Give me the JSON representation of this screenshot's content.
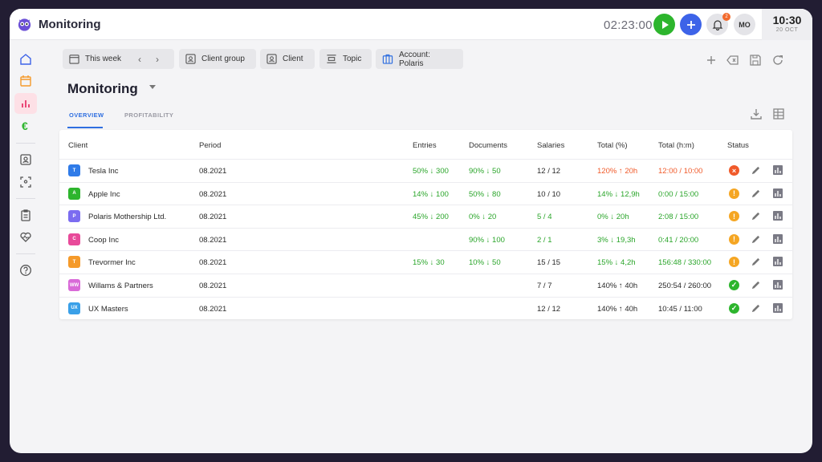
{
  "app": {
    "title": "Monitoring",
    "timer": "02:23:00",
    "avatar": "MO",
    "notifications": "2",
    "clock_time": "10:30",
    "clock_date": "20 OCT"
  },
  "filters": {
    "period": "This week",
    "client_group": "Client group",
    "client": "Client",
    "topic": "Topic",
    "account": "Account: Polaris"
  },
  "page": {
    "title": "Monitoring",
    "tabs": [
      "OVERVIEW",
      "PROFITABILITY"
    ]
  },
  "table": {
    "headers": [
      "Client",
      "Period",
      "Entries",
      "Documents",
      "Salaries",
      "Total (%)",
      "Total (h:m)",
      "Status"
    ],
    "rows": [
      {
        "initials": "T",
        "color": "#2f7be8",
        "client": "Tesla Inc",
        "period": "08.2021",
        "entries": "50% ↓ 300",
        "documents": "90% ↓ 50",
        "salaries": "12 / 12",
        "total_pct": "120% ↑ 20h",
        "total_hm": "12:00 / 10:00",
        "status": "error"
      },
      {
        "initials": "A",
        "color": "#2db52d",
        "client": "Apple Inc",
        "period": "08.2021",
        "entries": "14% ↓ 100",
        "documents": "50% ↓ 80",
        "salaries": "10 / 10",
        "total_pct": "14% ↓ 12,9h",
        "total_hm": "0:00 / 15:00",
        "status": "warning"
      },
      {
        "initials": "P",
        "color": "#7b6cf0",
        "client": "Polaris Mothership Ltd.",
        "period": "08.2021",
        "entries": "45% ↓ 200",
        "documents": "0% ↓ 20",
        "salaries": "5 / 4",
        "total_pct": "0% ↓ 20h",
        "total_hm": "2:08 / 15:00",
        "status": "warning"
      },
      {
        "initials": "C",
        "color": "#e84a9a",
        "client": "Coop Inc",
        "period": "08.2021",
        "entries": "",
        "documents": "90% ↓ 100",
        "salaries": "2 / 1",
        "total_pct": "3% ↓ 19,3h",
        "total_hm": "0:41 / 20:00",
        "status": "warning"
      },
      {
        "initials": "T",
        "color": "#f59a2a",
        "client": "Trevormer Inc",
        "period": "08.2021",
        "entries": "15% ↓ 30",
        "documents": "10% ↓ 50",
        "salaries": "15 / 15",
        "total_pct": "15% ↓ 4,2h",
        "total_hm": "156:48 / 330:00",
        "status": "warning"
      },
      {
        "initials": "WW",
        "color": "#d96ad8",
        "client": "Willams & Partners",
        "period": "08.2021",
        "entries": "",
        "documents": "",
        "salaries": "7 / 7",
        "total_pct": "140% ↑ 40h",
        "total_hm": "250:54 / 260:00",
        "status": "ok"
      },
      {
        "initials": "UX",
        "color": "#3aa0e8",
        "client": "UX Masters",
        "period": "08.2021",
        "entries": "",
        "documents": "",
        "salaries": "12 / 12",
        "total_pct": "140% ↑ 40h",
        "total_hm": "10:45 / 11:00",
        "status": "ok"
      }
    ]
  },
  "icons": [
    "logo-icon",
    "play-icon",
    "plus-icon",
    "bell-icon",
    "home-icon",
    "calendar-icon",
    "chart-icon",
    "euro-icon",
    "contact-card-icon",
    "scan-icon",
    "clipboard-icon",
    "heart-icon",
    "help-icon",
    "download-icon",
    "table-icon",
    "add-icon",
    "clear-icon",
    "save-icon",
    "refresh-icon",
    "edit-icon",
    "report-icon"
  ]
}
